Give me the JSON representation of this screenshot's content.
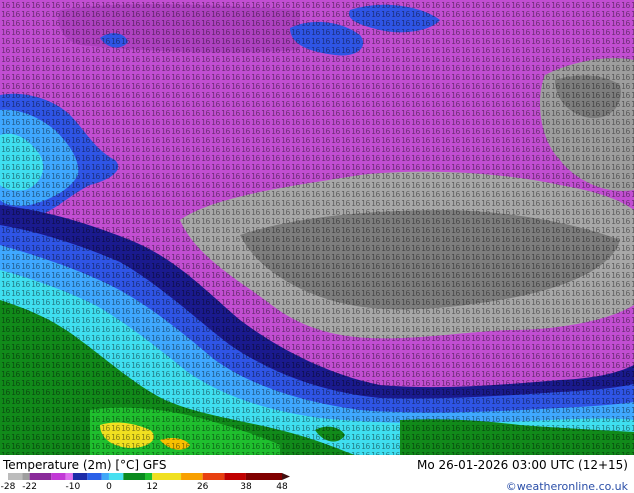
{
  "map": {
    "label_grid": true
  },
  "footer": {
    "title": "Temperature (2m) [°C] GFS",
    "valid_time": "Mo 26-01-2026 03:00 UTC (12+15)",
    "credit": "©weatheronline.co.uk"
  },
  "colorbar": {
    "ticks": [
      "-28",
      "-22",
      "-10",
      "0",
      "12",
      "26",
      "38",
      "48"
    ],
    "stops": [
      {
        "value": -28,
        "color": "#bcbcbc"
      },
      {
        "value": -24,
        "color": "#9e9e9e"
      },
      {
        "value": -22,
        "color": "#8a2a9a"
      },
      {
        "value": -16,
        "color": "#c238d6"
      },
      {
        "value": -12,
        "color": "#e070f0"
      },
      {
        "value": -10,
        "color": "#1c2ba8"
      },
      {
        "value": -6,
        "color": "#2a60e8"
      },
      {
        "value": -2,
        "color": "#40a8f8"
      },
      {
        "value": 0,
        "color": "#48e0f0"
      },
      {
        "value": 4,
        "color": "#0a8a1e"
      },
      {
        "value": 10,
        "color": "#1fbf2e"
      },
      {
        "value": 12,
        "color": "#f0e020"
      },
      {
        "value": 20,
        "color": "#f8a000"
      },
      {
        "value": 26,
        "color": "#e84010"
      },
      {
        "value": 32,
        "color": "#c00000"
      },
      {
        "value": 38,
        "color": "#800000"
      },
      {
        "value": 48,
        "color": "#401010"
      }
    ]
  },
  "palette": {
    "gray_core": "#7e7e7e",
    "gray_light": "#a8a8a8",
    "purple": "#c24ed2",
    "purple_dark": "#8e2fa0",
    "navy": "#1a1a8e",
    "blue": "#2f55e6",
    "light_blue": "#3fa8ff",
    "cyan": "#3fdff0",
    "green": "#118a1a",
    "yellow": "#f0e020"
  }
}
